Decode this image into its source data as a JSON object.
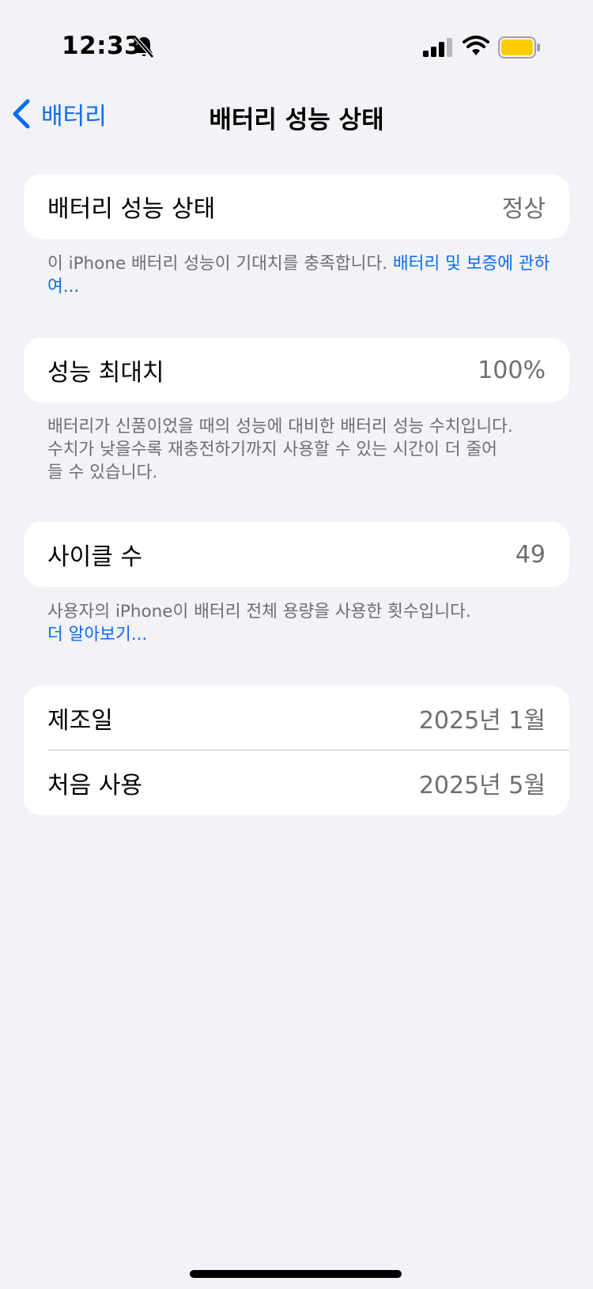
{
  "status_bar": {
    "time": "12:33",
    "icons": [
      "bell-slash-icon",
      "cellular-signal-icon",
      "wifi-icon",
      "battery-icon"
    ],
    "battery_color": "#ffcc00"
  },
  "nav": {
    "back_label": "배터리",
    "title": "배터리 성능 상태",
    "accent_color": "#0a6cf0"
  },
  "health_card": {
    "label": "배터리 성능 상태",
    "value": "정상"
  },
  "health_footnote": {
    "text": "이 iPhone 배터리 성능이 기대치를 충족합니다. ",
    "link": "배터리 및 보증에 관하여..."
  },
  "capacity_card": {
    "label": "성능 최대치",
    "value": "100%"
  },
  "capacity_footnote": {
    "line1": "배터리가 신품이었을 때의 성능에 대비한 배터리 성능 수치입니다.",
    "line2": "수치가 낮을수록 재충전하기까지 사용할 수 있는 시간이 더 줄어",
    "line3": "들 수 있습니다."
  },
  "cycle_card": {
    "label": "사이클 수",
    "value": "49"
  },
  "cycle_footnote": {
    "text": "사용자의 iPhone이 배터리 전체 용량을 사용한 횟수입니다.",
    "link": "더 알아보기..."
  },
  "dates_card": {
    "rows": [
      {
        "label": "제조일",
        "value": "2025년 1월"
      },
      {
        "label": "처음 사용",
        "value": "2025년 5월"
      }
    ]
  }
}
